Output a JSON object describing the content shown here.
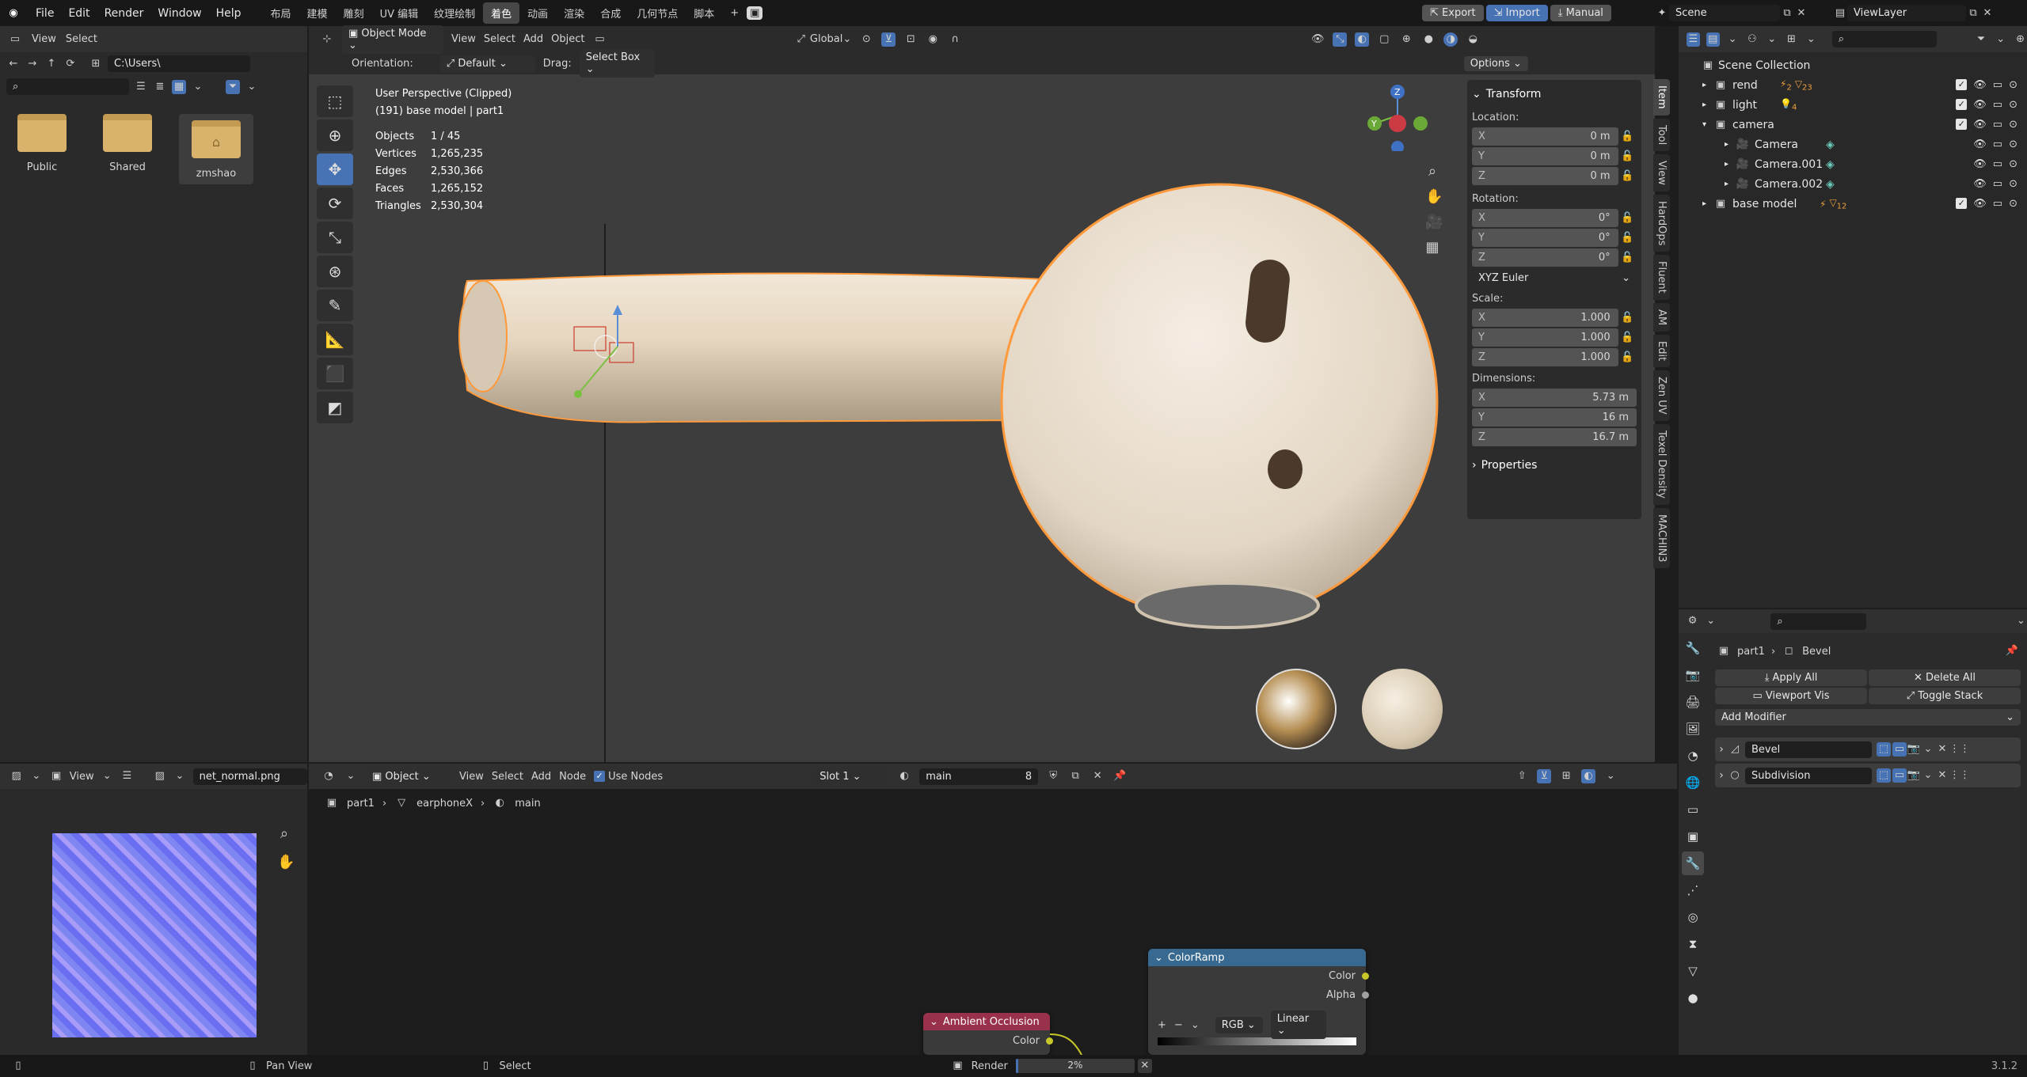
{
  "topbar": {
    "menu": [
      "File",
      "Edit",
      "Render",
      "Window",
      "Help"
    ],
    "workspaces": [
      "布局",
      "建模",
      "雕刻",
      "UV 编辑",
      "纹理绘制",
      "着色",
      "动画",
      "渲染",
      "合成",
      "几何节点",
      "脚本"
    ],
    "active_workspace": "着色",
    "export_label": "Export",
    "import_label": "Import",
    "manual_label": "Manual",
    "scene": "Scene",
    "view_layer": "ViewLayer"
  },
  "file_browser": {
    "menu": [
      "View",
      "Select"
    ],
    "path": "C:\\Users\\",
    "folders": [
      "Public",
      "Shared",
      "zmshao"
    ]
  },
  "viewport": {
    "mode": "Object Mode",
    "menu": [
      "View",
      "Select",
      "Add",
      "Object"
    ],
    "transform_orientation": "Global",
    "orientation_label": "Orientation:",
    "orientation_value": "Default",
    "drag_label": "Drag:",
    "drag_value": "Select Box",
    "options_label": "Options",
    "overlay_line1": "User Perspective (Clipped)",
    "overlay_line2": "(191) base model | part1",
    "stats": [
      {
        "label": "Objects",
        "value": "1 / 45"
      },
      {
        "label": "Vertices",
        "value": "1,265,235"
      },
      {
        "label": "Edges",
        "value": "2,530,366"
      },
      {
        "label": "Faces",
        "value": "1,265,152"
      },
      {
        "label": "Triangles",
        "value": "2,530,304"
      }
    ],
    "gizmo_axes": {
      "x": "X",
      "y": "Y",
      "z": "Z"
    }
  },
  "transform_panel": {
    "title": "Transform",
    "location_label": "Location:",
    "location": [
      {
        "axis": "X",
        "value": "0 m"
      },
      {
        "axis": "Y",
        "value": "0 m"
      },
      {
        "axis": "Z",
        "value": "0 m"
      }
    ],
    "rotation_label": "Rotation:",
    "rotation": [
      {
        "axis": "X",
        "value": "0°"
      },
      {
        "axis": "Y",
        "value": "0°"
      },
      {
        "axis": "Z",
        "value": "0°"
      }
    ],
    "rotation_mode": "XYZ Euler",
    "scale_label": "Scale:",
    "scale": [
      {
        "axis": "X",
        "value": "1.000"
      },
      {
        "axis": "Y",
        "value": "1.000"
      },
      {
        "axis": "Z",
        "value": "1.000"
      }
    ],
    "dimensions_label": "Dimensions:",
    "dimensions": [
      {
        "axis": "X",
        "value": "5.73 m"
      },
      {
        "axis": "Y",
        "value": "16 m"
      },
      {
        "axis": "Z",
        "value": "16.7 m"
      }
    ],
    "properties_label": "Properties"
  },
  "side_tabs": [
    "Item",
    "Tool",
    "View",
    "HardOps",
    "Fluent",
    "AM",
    "Edit",
    "Zen UV",
    "Texel Density",
    "MACHIN3"
  ],
  "outliner": {
    "root": "Scene Collection",
    "items": [
      {
        "name": "rend",
        "indent": 1,
        "badge1": "2",
        "badge2": "23"
      },
      {
        "name": "light",
        "indent": 1,
        "badge1": "4",
        "badge2": ""
      },
      {
        "name": "camera",
        "indent": 1,
        "badge1": "",
        "badge2": ""
      },
      {
        "name": "Camera",
        "indent": 2,
        "badge1": "",
        "badge2": ""
      },
      {
        "name": "Camera.001",
        "indent": 2,
        "badge1": "",
        "badge2": ""
      },
      {
        "name": "Camera.002",
        "indent": 2,
        "badge1": "",
        "badge2": ""
      },
      {
        "name": "base model",
        "indent": 1,
        "badge1": "",
        "badge2": "12"
      }
    ]
  },
  "properties": {
    "breadcrumb_object": "part1",
    "breadcrumb_modifier": "Bevel",
    "apply_all": "Apply All",
    "delete_all": "Delete All",
    "viewport_vis": "Viewport Vis",
    "toggle_stack": "Toggle Stack",
    "add_modifier": "Add Modifier",
    "modifiers": [
      "Bevel",
      "Subdivision"
    ]
  },
  "image_editor": {
    "view_label": "View",
    "image_name": "net_normal.png"
  },
  "node_editor": {
    "object_type": "Object",
    "menu": [
      "View",
      "Select",
      "Add",
      "Node"
    ],
    "use_nodes_label": "Use Nodes",
    "slot": "Slot 1",
    "material": "main",
    "users": "8",
    "breadcrumb": [
      "part1",
      "earphoneX",
      "main"
    ],
    "colorramp": {
      "title": "ColorRamp",
      "out_color": "Color",
      "out_alpha": "Alpha",
      "mode": "RGB",
      "interp": "Linear"
    },
    "ao": {
      "title": "Ambient Occlusion",
      "out_color": "Color"
    }
  },
  "statusbar": {
    "pan_view": "Pan View",
    "select": "Select",
    "render_label": "Render",
    "render_progress": "2%",
    "progress_value": 0.02,
    "version": "3.1.2"
  }
}
